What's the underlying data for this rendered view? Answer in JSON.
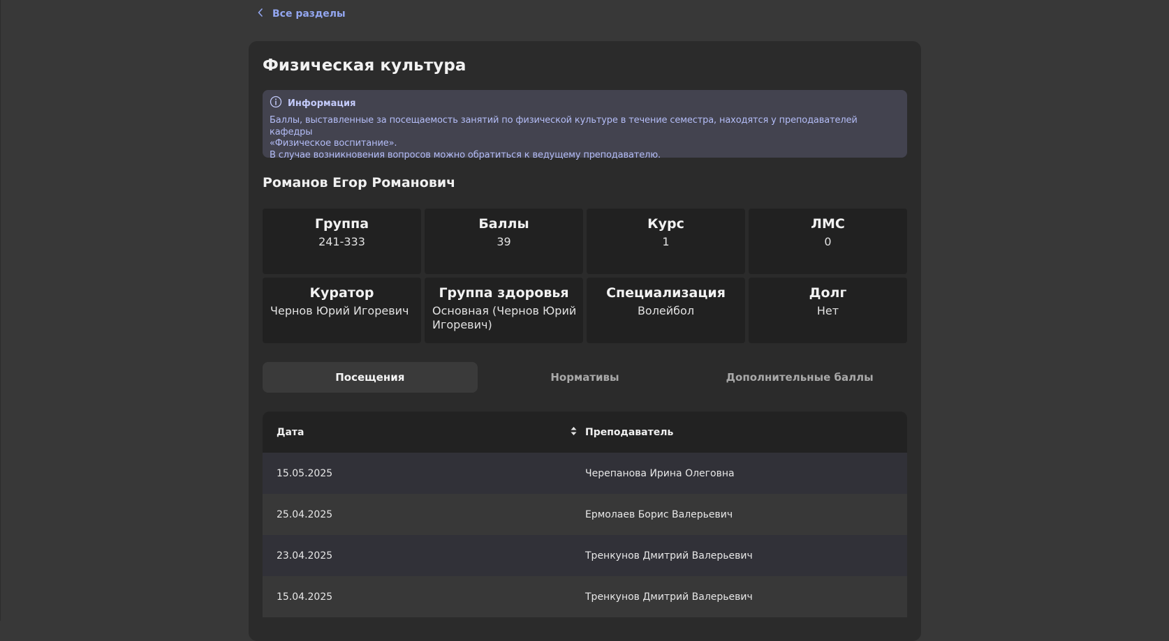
{
  "nav": {
    "back_label": "Все разделы"
  },
  "page": {
    "title": "Физическая культура"
  },
  "info": {
    "title": "Информация",
    "line1": "Баллы, выставленные за посещаемость занятий по физической культуре в течение семестра, находятся у преподавателей кафедры",
    "line2": "«Физическое воспитание».",
    "line3": "В случае возникновения вопросов можно обратиться к ведущему преподавателю."
  },
  "student": {
    "name": "Романов Егор Романович"
  },
  "stats": [
    {
      "label": "Группа",
      "value": "241-333"
    },
    {
      "label": "Баллы",
      "value": "39"
    },
    {
      "label": "Курс",
      "value": "1"
    },
    {
      "label": "ЛМС",
      "value": "0"
    },
    {
      "label": "Куратор",
      "value": "Чернов Юрий Игоревич"
    },
    {
      "label": "Группа здоровья",
      "value": "Основная (Чернов Юрий Игоревич)"
    },
    {
      "label": "Специализация",
      "value": "Волейбол"
    },
    {
      "label": "Долг",
      "value": "Нет"
    }
  ],
  "tabs": [
    {
      "label": "Посещения",
      "active": true
    },
    {
      "label": "Нормативы",
      "active": false
    },
    {
      "label": "Дополнительные баллы",
      "active": false
    }
  ],
  "table": {
    "columns": [
      "Дата",
      "Преподаватель"
    ],
    "rows": [
      {
        "date": "15.05.2025",
        "teacher": "Черепанова Ирина Олеговна"
      },
      {
        "date": "25.04.2025",
        "teacher": "Ермолаев Борис Валерьевич"
      },
      {
        "date": "23.04.2025",
        "teacher": "Тренкунов Дмитрий Валерьевич"
      },
      {
        "date": "15.04.2025",
        "teacher": "Тренкунов Дмитрий Валерьевич"
      }
    ]
  },
  "colors": {
    "background": "#383838",
    "card": "#2b2b2b",
    "accent": "#93a6f0",
    "info_bg": "#43434f",
    "stat_bg": "#212121"
  },
  "icons": {
    "back": "chevron-left-icon",
    "info": "info-circle-icon",
    "sort": "sort-icon"
  }
}
